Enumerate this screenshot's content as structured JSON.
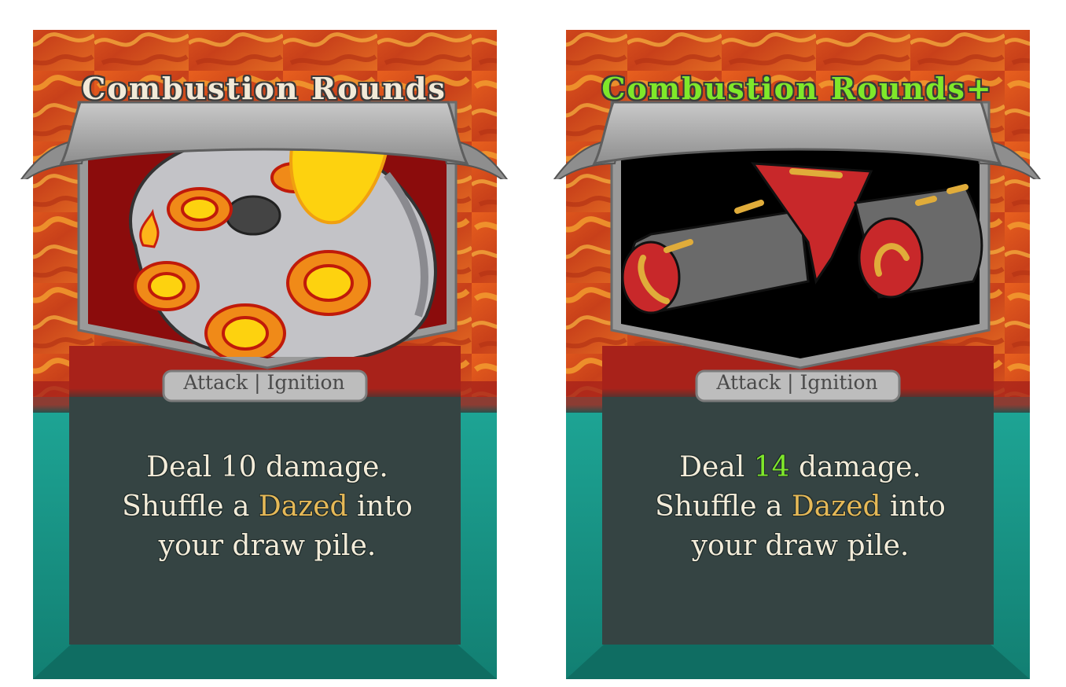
{
  "colors": {
    "flame_border": "#d8501c",
    "teal_border": "#17998a",
    "description_panel": "#354443",
    "type_banner": "#9a1512",
    "keyword": "#e6b957",
    "upgraded_title": "#7fe82a",
    "upgraded_value": "#7fe82a",
    "title_plain": "#f2ead8"
  },
  "cards": [
    {
      "title": "Combustion Rounds",
      "type_line": "Attack | Ignition",
      "art_icon": "revolver-cylinder-flames-icon",
      "description": {
        "line1_pre": "Deal ",
        "damage": "10",
        "line1_post": " damage.",
        "line2_pre": "Shuffle a ",
        "keyword": "Dazed",
        "line2_post": " into",
        "line3": "your draw pile."
      }
    },
    {
      "title": "Combustion Rounds+",
      "type_line": "Attack | Ignition",
      "art_icon": "broken-bullets-icon",
      "description": {
        "line1_pre": "Deal ",
        "damage": "14",
        "line1_post": " damage.",
        "line2_pre": "Shuffle a ",
        "keyword": "Dazed",
        "line2_post": " into",
        "line3": "your draw pile."
      }
    }
  ]
}
